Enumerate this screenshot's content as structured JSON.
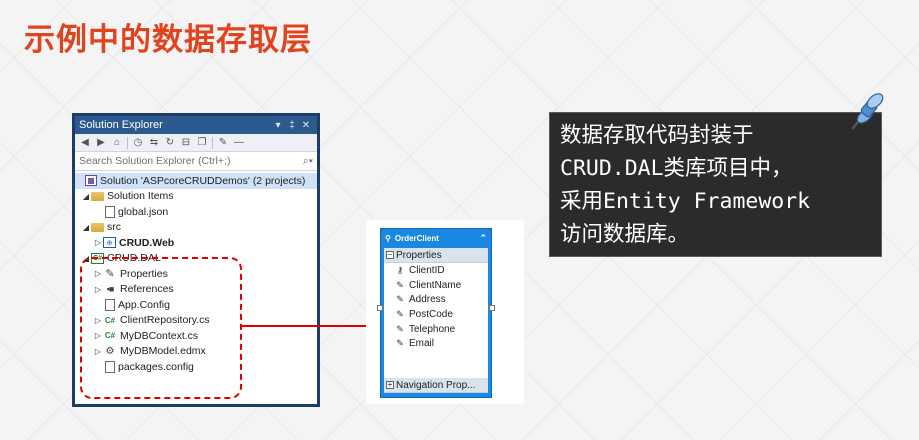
{
  "slide": {
    "title": "示例中的数据存取层"
  },
  "solution_explorer": {
    "title": "Solution Explorer",
    "title_controls": [
      "▾",
      "‡",
      "✕"
    ],
    "search_placeholder": "Search Solution Explorer (Ctrl+;)",
    "search_icon": "search-icon",
    "tree": {
      "solution": "Solution 'ASPcoreCRUDDemos' (2 projects)",
      "solution_items": "Solution Items",
      "global_json": "global.json",
      "src": "src",
      "crud_web": "CRUD.Web",
      "crud_dal": "CRUD.DAL",
      "properties": "Properties",
      "references": "References",
      "app_config": "App.Config",
      "client_repository": "ClientRepository.cs",
      "db_context": "MyDBContext.cs",
      "db_model": "MyDBModel.edmx",
      "packages_config": "packages.config"
    }
  },
  "entity": {
    "name": "OrderClient",
    "properties_label": "Properties",
    "properties": [
      "ClientID",
      "ClientName",
      "Address",
      "PostCode",
      "Telephone",
      "Email"
    ],
    "navigation_label": "Navigation Prop..."
  },
  "callout": {
    "line1": "数据存取代码封装于",
    "line2": "CRUD.DAL类库项目中，",
    "line3": "采用Entity Framework",
    "line4": "访问数据库。"
  },
  "colors": {
    "title": "#e0431d",
    "highlight": "#e00000",
    "explorer_frame": "#1e3c66",
    "entity_blue": "#1a87e0",
    "callout_bg": "#2b2b2b"
  }
}
